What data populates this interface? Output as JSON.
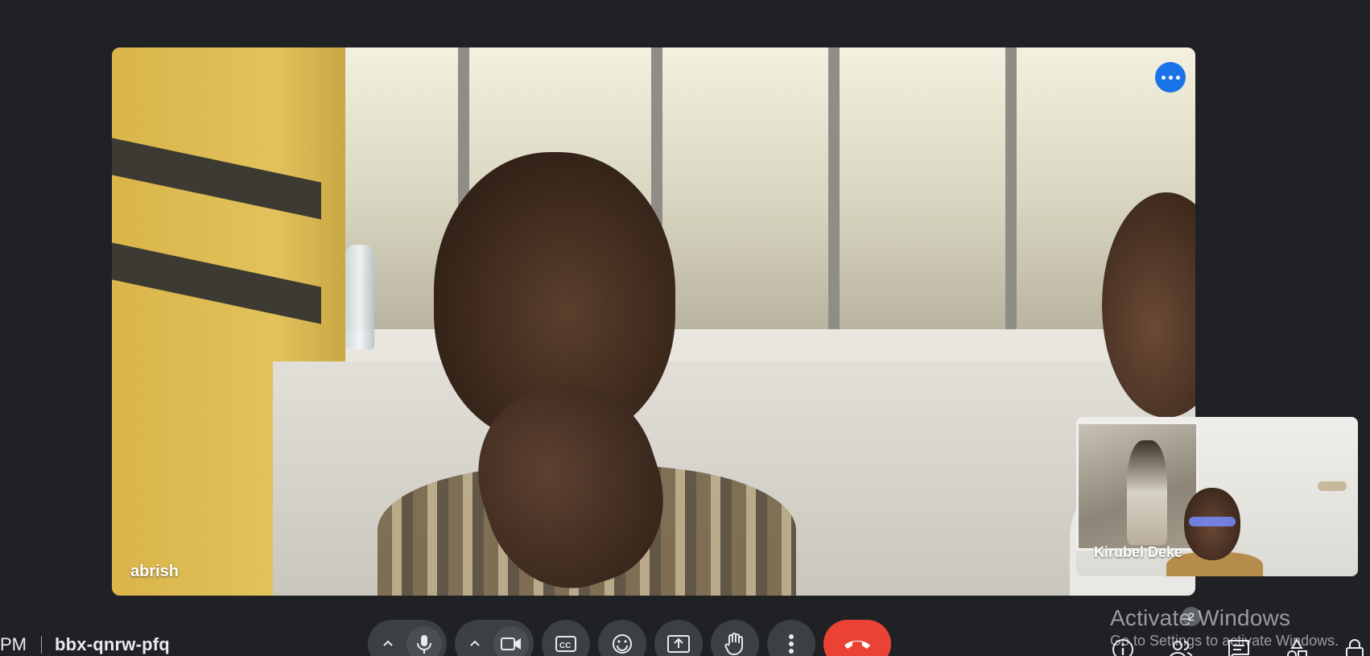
{
  "main_participant": {
    "name": "abrish",
    "options_icon": "more-horiz-icon"
  },
  "self_view": {
    "name": "Kirubel Deke"
  },
  "meeting": {
    "time": "PM",
    "code": "bbx-qnrw-pfq"
  },
  "controls": {
    "mic": {
      "icon": "microphone-icon",
      "caret_icon": "chevron-up-icon"
    },
    "camera": {
      "icon": "video-camera-icon",
      "caret_icon": "chevron-up-icon"
    },
    "captions": {
      "icon": "closed-captions-icon"
    },
    "reactions": {
      "icon": "emoji-icon"
    },
    "present": {
      "icon": "present-screen-icon"
    },
    "raise_hand": {
      "icon": "raise-hand-icon"
    },
    "more": {
      "icon": "more-vert-icon"
    },
    "leave": {
      "icon": "hang-up-icon",
      "color": "#ea4335"
    }
  },
  "right_tools": {
    "info": {
      "icon": "info-icon"
    },
    "people": {
      "icon": "people-icon",
      "count": "2"
    },
    "chat": {
      "icon": "chat-icon"
    },
    "activities": {
      "icon": "activities-icon"
    },
    "host_controls": {
      "icon": "lock-icon"
    }
  },
  "watermark": {
    "title": "Activate Windows",
    "subtitle": "Go to Settings to activate Windows."
  },
  "colors": {
    "background": "#202124",
    "control_bg": "#3c4043",
    "accent_blue": "#1a73e8",
    "hangup_red": "#ea4335"
  }
}
